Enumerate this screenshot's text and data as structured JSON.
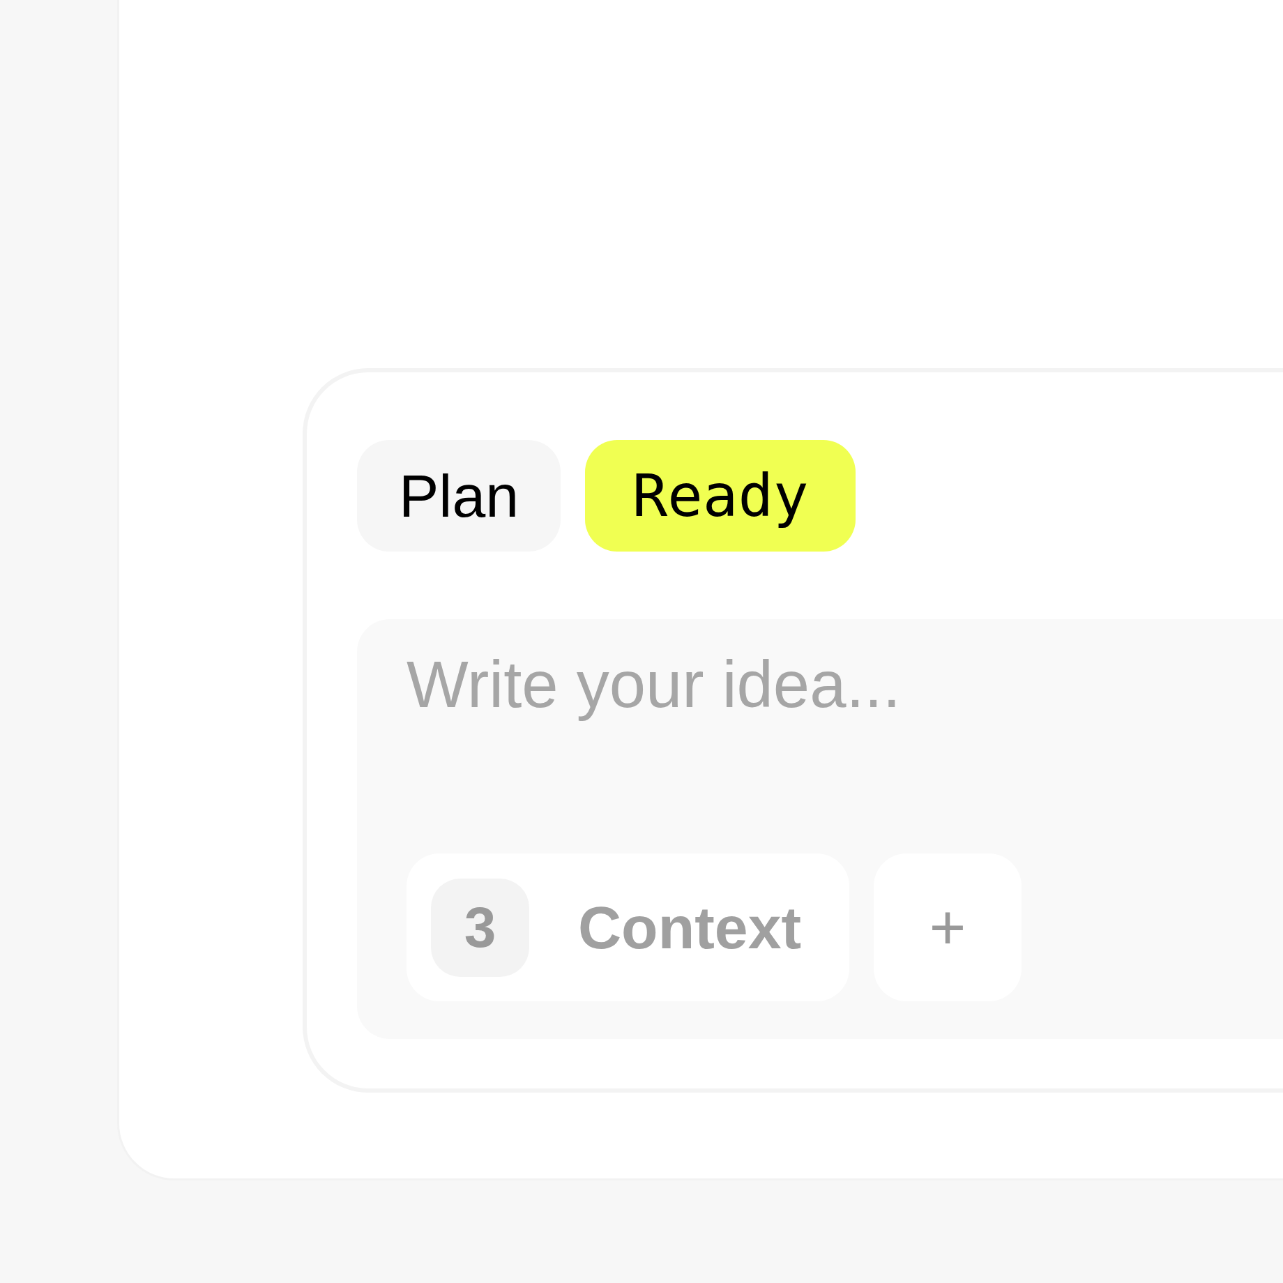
{
  "tabs": [
    {
      "label": "Plan",
      "selected": false
    },
    {
      "label": "Ready",
      "selected": true
    }
  ],
  "composer": {
    "placeholder": "Write your idea...",
    "context": {
      "count": "3",
      "label": "Context"
    },
    "add_button": "+"
  }
}
